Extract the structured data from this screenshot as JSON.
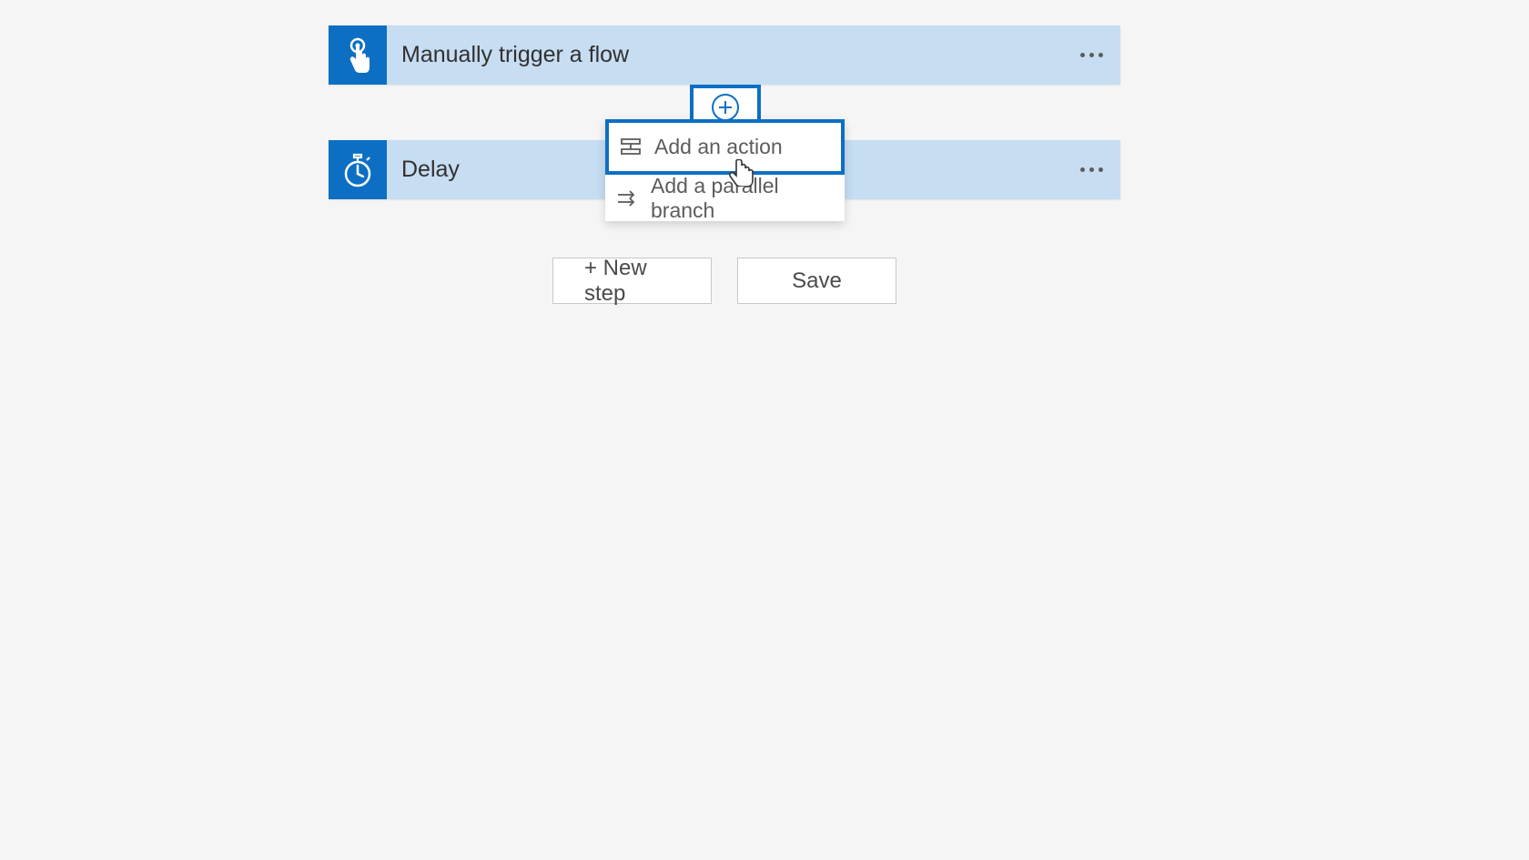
{
  "steps": {
    "trigger": {
      "title": "Manually trigger a flow"
    },
    "delay": {
      "title": "Delay"
    }
  },
  "popup": {
    "addAction": "Add an action",
    "addParallel": "Add a parallel branch"
  },
  "buttons": {
    "newStep": "+ New step",
    "save": "Save"
  }
}
